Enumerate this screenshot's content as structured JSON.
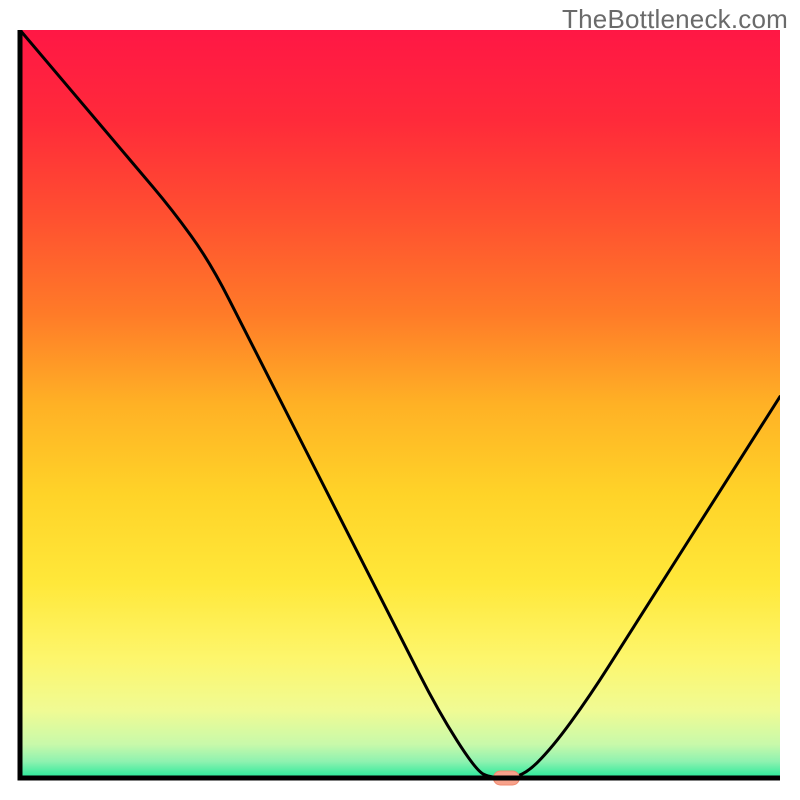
{
  "watermark": "TheBottleneck.com",
  "colors": {
    "curve": "#000000",
    "marker_fill": "#f7a28b",
    "marker_stroke": "#f08a6f",
    "axis": "#000000",
    "gradient_stops": [
      {
        "offset": 0.0,
        "color": "#ff1745"
      },
      {
        "offset": 0.12,
        "color": "#ff2a3a"
      },
      {
        "offset": 0.25,
        "color": "#ff5030"
      },
      {
        "offset": 0.38,
        "color": "#ff7b28"
      },
      {
        "offset": 0.5,
        "color": "#ffb125"
      },
      {
        "offset": 0.62,
        "color": "#ffd328"
      },
      {
        "offset": 0.74,
        "color": "#ffe83a"
      },
      {
        "offset": 0.84,
        "color": "#fdf66c"
      },
      {
        "offset": 0.91,
        "color": "#f0fb94"
      },
      {
        "offset": 0.955,
        "color": "#c8f9aa"
      },
      {
        "offset": 0.978,
        "color": "#8ef2b0"
      },
      {
        "offset": 1.0,
        "color": "#25e99a"
      }
    ]
  },
  "chart_data": {
    "type": "line",
    "title": "",
    "xlabel": "",
    "ylabel": "",
    "x": [
      0,
      5,
      10,
      15,
      20,
      25,
      30,
      35,
      40,
      45,
      50,
      55,
      60,
      62,
      66,
      70,
      75,
      80,
      85,
      90,
      95,
      100
    ],
    "values": [
      100,
      94,
      88,
      82,
      76,
      69,
      59,
      49,
      39,
      29,
      19,
      9,
      1,
      0,
      0,
      4,
      11,
      19,
      27,
      35,
      43,
      51
    ],
    "xlim": [
      0,
      100
    ],
    "ylim": [
      0,
      100
    ],
    "marker": {
      "x": 64,
      "y": 0
    }
  }
}
